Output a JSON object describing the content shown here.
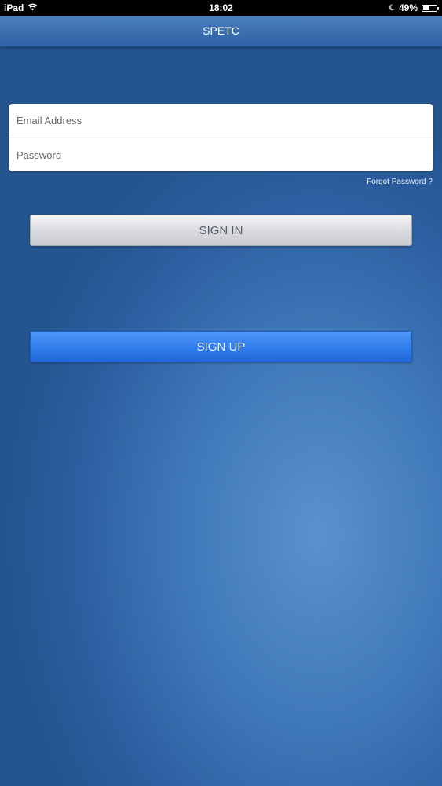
{
  "status_bar": {
    "device": "iPad",
    "time": "18:02",
    "battery_percent": "49%",
    "battery_level": 0.49,
    "icons": [
      "wifi-icon",
      "moon-icon",
      "battery-icon"
    ]
  },
  "nav_bar": {
    "title": "SPETC"
  },
  "login_form": {
    "email_placeholder": "Email Address",
    "email_value": "",
    "password_placeholder": "Password",
    "password_value": ""
  },
  "forgot_password_label": "Forgot Password ?",
  "buttons": {
    "sign_in_label": "SIGN IN",
    "sign_up_label": "SIGN UP"
  },
  "colors": {
    "background": "#3f78b8",
    "nav_bar": "#3a6dae",
    "sign_in_button": "#d9dadf",
    "sign_up_button": "#2f7cec"
  }
}
